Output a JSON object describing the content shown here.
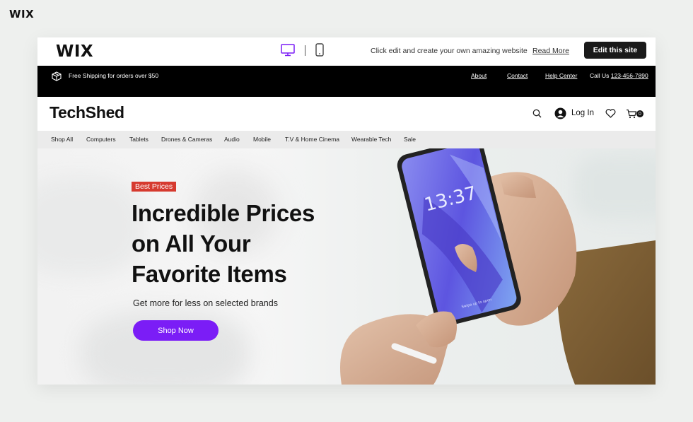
{
  "corner_logo": "WIX",
  "wix_bar": {
    "logo": "WIX",
    "message": "Click edit and create your own amazing website",
    "read_more": "Read More",
    "edit_button": "Edit this site",
    "active_device": "desktop",
    "accent_color": "#7b1df6"
  },
  "announcement": {
    "shipping_text": "Free Shipping for orders over $50",
    "links": [
      "About",
      "Contact",
      "Help Center"
    ],
    "call_label": "Call Us",
    "phone": "123-456-7890"
  },
  "header": {
    "logo": "TechShed",
    "login_label": "Log In",
    "cart_count": "0"
  },
  "nav": {
    "items": [
      "Shop All",
      "Computers",
      "Tablets",
      "Drones & Cameras",
      "Audio",
      "Mobile",
      "T.V & Home Cinema",
      "Wearable Tech",
      "Sale"
    ]
  },
  "hero": {
    "badge": "Best Prices",
    "headline_lines": [
      "Incredible Prices",
      "on All Your",
      "Favorite Items"
    ],
    "subheadline": "Get more for less on selected brands",
    "cta": "Shop Now",
    "phone_time": "13:37",
    "phone_swipe": "Swipe up to open",
    "badge_color": "#d63a2f",
    "cta_color": "#7b1df6"
  }
}
